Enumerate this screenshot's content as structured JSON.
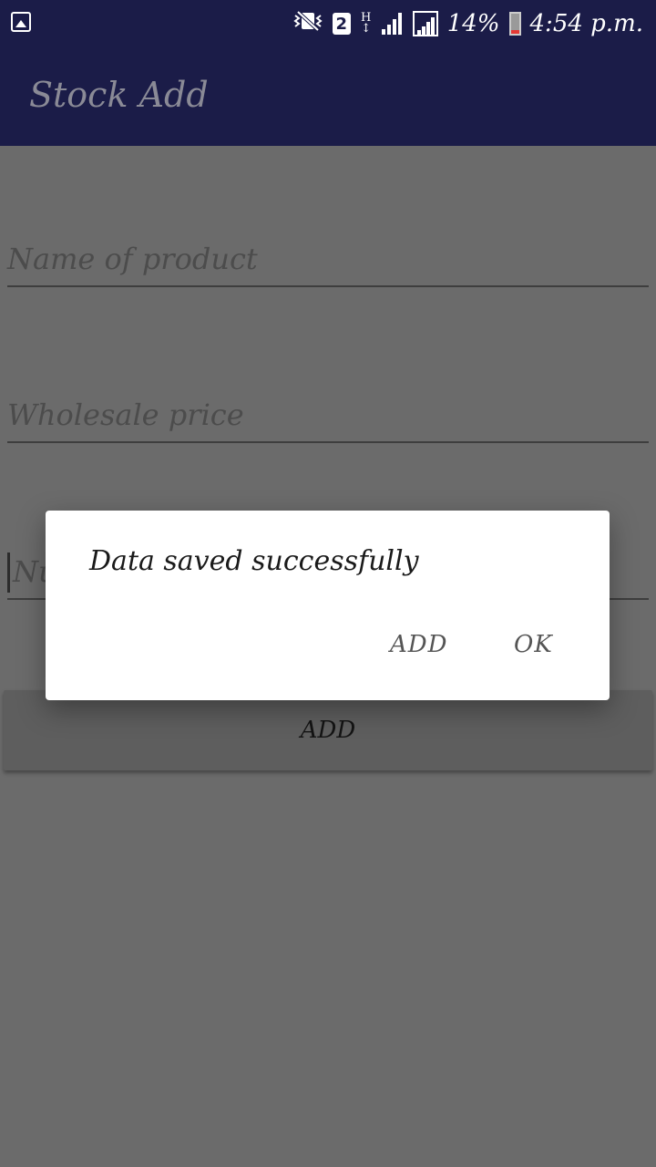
{
  "status_bar": {
    "sim_slot": "2",
    "network_type": "H",
    "battery_percent": "14%",
    "time": "4:54 p.m.",
    "battery_level": 0.14,
    "battery_low_color": "#e53935",
    "icons": [
      "image-icon",
      "vibrate-icon",
      "sim-2-icon",
      "h-network-icon",
      "signal-icon",
      "signal-icon",
      "battery-icon"
    ]
  },
  "app_bar": {
    "title": "Stock Add",
    "background": "#1b1c48"
  },
  "form": {
    "product_name_placeholder": "Name of product",
    "wholesale_price_placeholder": "Wholesale price",
    "third_field_visible_text": "Nu",
    "add_button_label": "ADD"
  },
  "dialog": {
    "message": "Data saved successfully",
    "add_button_label": "ADD",
    "ok_button_label": "OK"
  }
}
